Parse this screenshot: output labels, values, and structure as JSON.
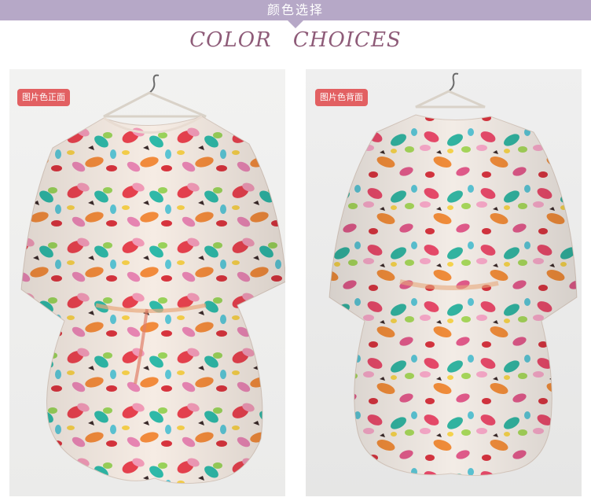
{
  "header": {
    "title_cn": "颜色选择",
    "title_en": "COLOR CHOICES"
  },
  "panels": [
    {
      "label": "图片色正面"
    },
    {
      "label": "图片色背面"
    }
  ],
  "colors": {
    "band": "#b6a8c7",
    "heading": "#8e5b78",
    "badge": "#e26062"
  }
}
